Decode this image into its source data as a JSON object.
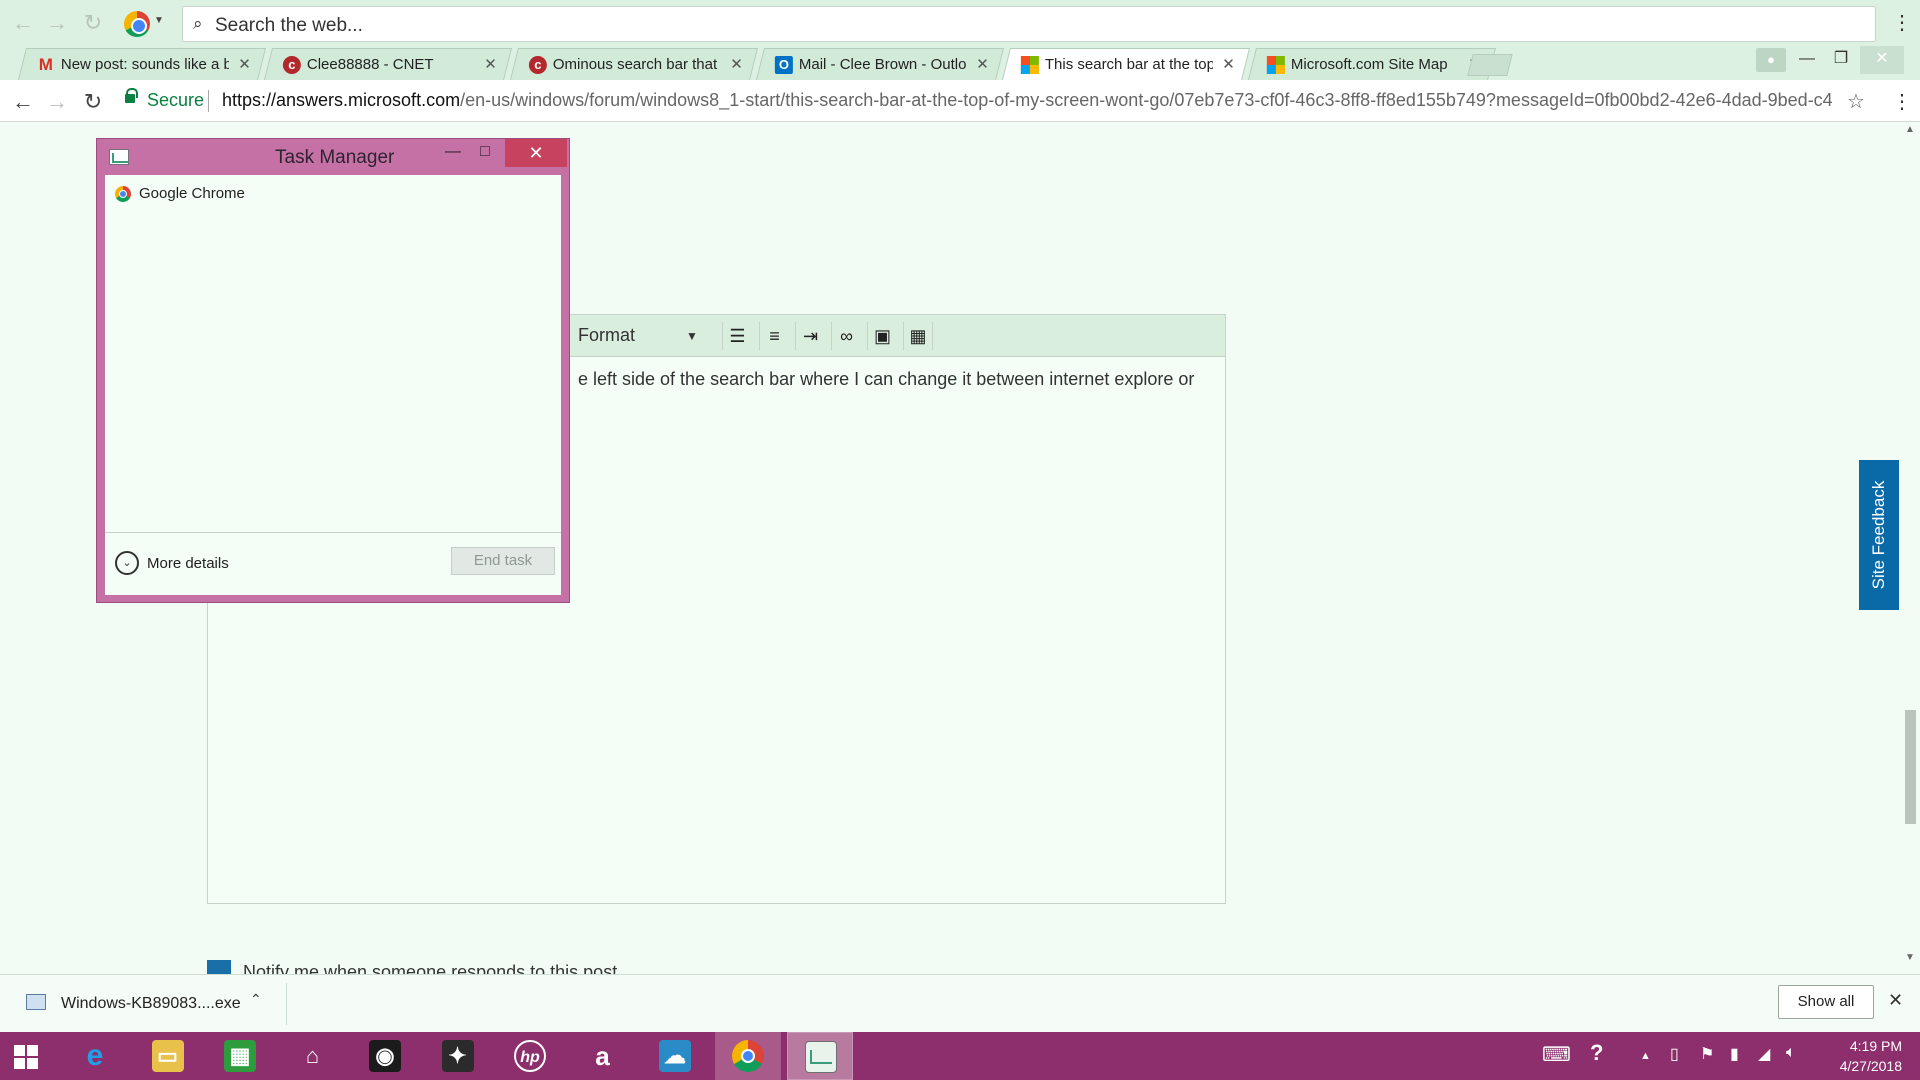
{
  "browser": {
    "search_placeholder": "Search the web...",
    "tabs": [
      {
        "label": "New post: sounds like a b",
        "icon": "gmail-icon",
        "icon_glyph": "M",
        "icon_color": "#d93025",
        "active": false
      },
      {
        "label": "Clee88888 - CNET",
        "icon": "cnet-icon",
        "icon_glyph": "c",
        "icon_color": "#b3282d",
        "active": false
      },
      {
        "label": "Ominous search bar that",
        "icon": "cnet-icon",
        "icon_glyph": "c",
        "icon_color": "#b3282d",
        "active": false
      },
      {
        "label": "Mail - Clee Brown - Outlo",
        "icon": "outlook-icon",
        "icon_glyph": "O",
        "icon_color": "#0072c6",
        "active": false
      },
      {
        "label": "This search bar at the top",
        "icon": "microsoft-icon",
        "icon_glyph": "",
        "icon_color": "#f25022",
        "active": true
      },
      {
        "label": "Microsoft.com Site Map",
        "icon": "microsoft-icon",
        "icon_glyph": "",
        "icon_color": "#f25022",
        "active": false
      }
    ],
    "address": {
      "secure_label": "Secure",
      "url_scheme_host": "https://answers.microsoft.com",
      "url_path": "/en-us/windows/forum/windows8_1-start/this-search-bar-at-the-top-of-my-screen-wont-go/07eb7e73-cf0f-46c3-8ff8-ff8ed155b749?messageId=0fb00bd2-42e6-4dad-9bed-c4..."
    }
  },
  "editor": {
    "format_label": "Format",
    "body_text": "e left side of the search bar where I can change it between internet explore or",
    "notify_label": "Notify me when someone responds to this post"
  },
  "site_feedback": "Site Feedback",
  "task_manager": {
    "title": "Task Manager",
    "apps": [
      "Google Chrome"
    ],
    "more_details": "More details",
    "end_task": "End task"
  },
  "download_bar": {
    "file_name": "Windows-KB89083....exe",
    "show_all": "Show all"
  },
  "taskbar": {
    "apps": [
      {
        "name": "internet-explorer-icon",
        "glyph": "e",
        "color": "#1ea0e6"
      },
      {
        "name": "file-explorer-icon",
        "glyph": "▭",
        "color": "#e8c14a"
      },
      {
        "name": "store-icon",
        "glyph": "▦",
        "color": "#2c9c3c"
      },
      {
        "name": "home-icon",
        "glyph": "⌂",
        "color": "transparent"
      },
      {
        "name": "camera-app-icon",
        "glyph": "◉",
        "color": "#1b1b1b"
      },
      {
        "name": "media-app-icon",
        "glyph": "✦",
        "color": "#2b2b2b"
      },
      {
        "name": "hp-icon",
        "glyph": "hp",
        "color": "transparent"
      },
      {
        "name": "amazon-icon",
        "glyph": "a",
        "color": "transparent"
      },
      {
        "name": "onedrive-icon",
        "glyph": "☁",
        "color": "#2a8bc7"
      },
      {
        "name": "chrome-icon",
        "glyph": "",
        "color": "transparent"
      },
      {
        "name": "task-manager-icon",
        "glyph": "",
        "color": "transparent"
      }
    ],
    "clock_time": "4:19 PM",
    "clock_date": "4/27/2018"
  }
}
